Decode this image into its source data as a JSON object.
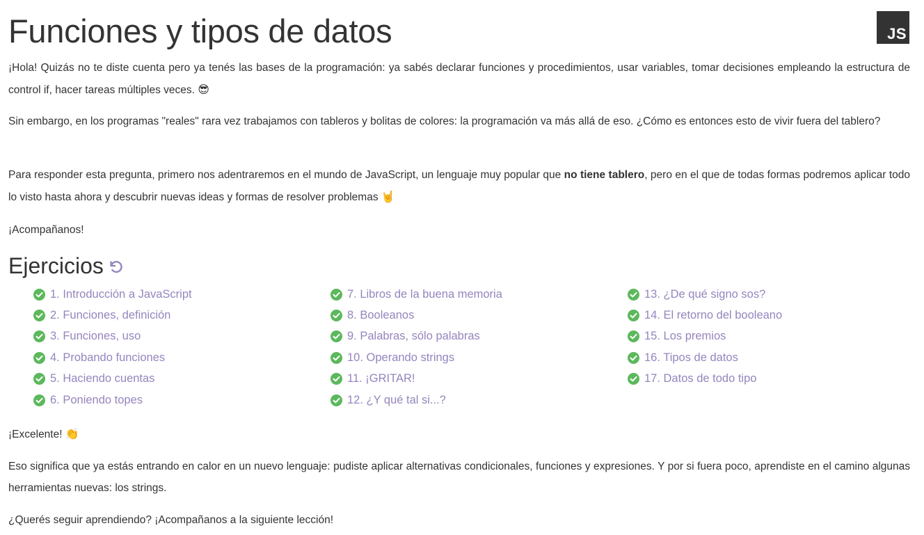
{
  "page": {
    "title": "Funciones y tipos de datos",
    "badge": "JS",
    "intro": {
      "p1": "¡Hola! Quizás no te diste cuenta pero ya tenés las bases de la programación: ya sabés declarar funciones y procedimientos, usar variables, tomar decisiones empleando la estructura de control if, hacer tareas múltiples veces.",
      "p1_emoji": "😎",
      "p2": "Sin embargo, en los programas \"reales\" rara vez trabajamos con tableros y bolitas de colores: la programación va más allá de eso. ¿Cómo es entonces esto de vivir fuera del tablero?",
      "p3_a": "Para responder esta pregunta, primero nos adentraremos en el mundo de JavaScript, un lenguaje muy popular que ",
      "p3_bold": "no tiene tablero",
      "p3_b": ", pero en el que de todas formas podremos aplicar todo lo visto hasta ahora y descubrir nuevas ideas y formas de resolver problemas",
      "p3_emoji": "🤘",
      "p4": "¡Acompañanos!"
    },
    "exercises_title": "Ejercicios",
    "exercises": [
      [
        "1. Introducción a JavaScript",
        "2. Funciones, definición",
        "3. Funciones, uso",
        "4. Probando funciones",
        "5. Haciendo cuentas",
        "6. Poniendo topes"
      ],
      [
        "7. Libros de la buena memoria",
        "8. Booleanos",
        "9. Palabras, sólo palabras",
        "10. Operando strings",
        "11. ¡GRITAR!",
        "12. ¿Y qué tal si...?"
      ],
      [
        "13. ¿De qué signo sos?",
        "14. El retorno del booleano",
        "15. Los premios",
        "16. Tipos de datos",
        "17. Datos de todo tipo"
      ]
    ],
    "outro": {
      "p1": "¡Excelente!",
      "p1_emoji": "👏",
      "p2": "Eso significa que ya estás entrando en calor en un nuevo lenguaje: pudiste aplicar alternativas condicionales, funciones y expresiones. Y por si fuera poco, aprendiste en el camino algunas herramientas nuevas: los strings.",
      "p3": "¿Querés seguir aprendiendo? ¡Acompañanos a la siguiente lección!"
    }
  },
  "colors": {
    "link": "#9585be",
    "check": "#5cb85c",
    "text": "#333333",
    "badge_bg": "#333333"
  },
  "icons": [
    "js-logo-icon",
    "reset-icon",
    "check-circle-icon"
  ]
}
